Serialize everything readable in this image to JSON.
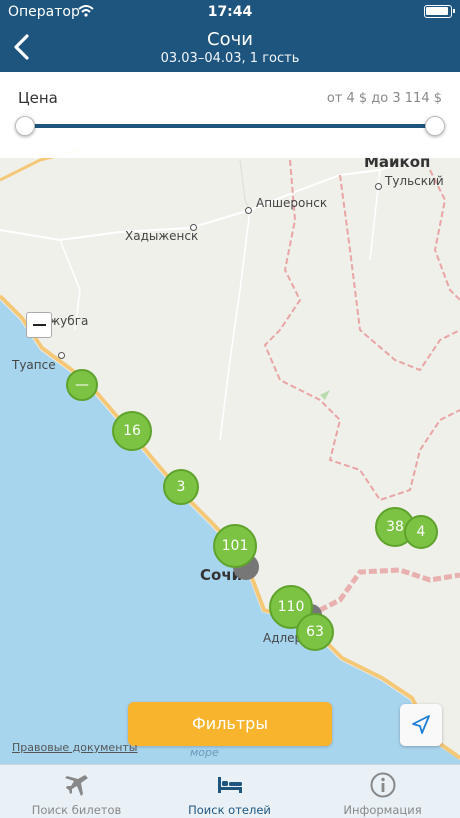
{
  "status_bar": {
    "carrier": "Оператор",
    "time": "17:44"
  },
  "header": {
    "title": "Сочи",
    "subtitle": "03.03–04.03, 1 гость"
  },
  "price_filter": {
    "label": "Цена",
    "range": "от 4 $ до 3 114 $"
  },
  "map": {
    "cities": {
      "maykop": "Майкоп",
      "tulsky": "Тульский",
      "apsheronsk": "Апшеронск",
      "khadyzhensk": "Хадыженск",
      "dzhubga": "Джубга",
      "tuapse": "Туапсе",
      "sochi": "Сочи",
      "adler": "Адлер"
    },
    "clusters": [
      "—",
      "16",
      "3",
      "101",
      "38",
      "4",
      "110",
      "63"
    ],
    "sea_label": "море",
    "legal_link": "Правовые документы"
  },
  "buttons": {
    "filters": "Фильтры"
  },
  "tabs": [
    {
      "label": "Поиск билетов",
      "icon": "airplane-icon"
    },
    {
      "label": "Поиск отелей",
      "icon": "bed-icon"
    },
    {
      "label": "Информация",
      "icon": "info-icon"
    }
  ],
  "colors": {
    "header": "#1e557f",
    "accent": "#f7b42c",
    "cluster": "#7cc243",
    "sea": "#a8d5ee"
  }
}
